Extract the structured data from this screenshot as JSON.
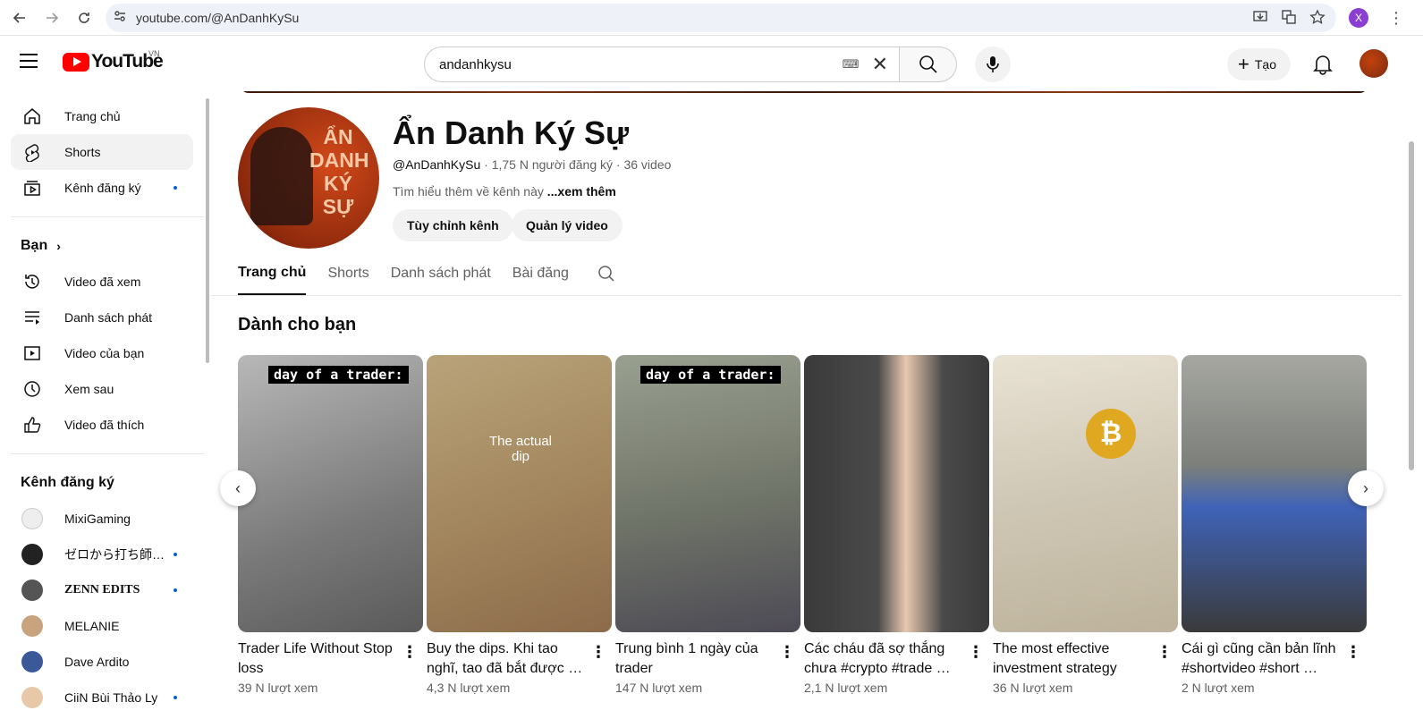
{
  "browser": {
    "url": "youtube.com/@AnDanhKySu",
    "profile_initial": "X"
  },
  "header": {
    "logo_text": "YouTube",
    "region": "VN",
    "search_value": "andanhkysu",
    "create_label": "Tạo"
  },
  "sidebar": {
    "main_items": [
      {
        "label": "Trang chủ",
        "icon": "home-icon"
      },
      {
        "label": "Shorts",
        "icon": "shorts-icon"
      },
      {
        "label": "Kênh đăng ký",
        "icon": "subscriptions-icon"
      }
    ],
    "you_heading": "Bạn",
    "you_items": [
      {
        "label": "Video đã xem",
        "icon": "history-icon"
      },
      {
        "label": "Danh sách phát",
        "icon": "playlist-icon"
      },
      {
        "label": "Video của bạn",
        "icon": "your-videos-icon"
      },
      {
        "label": "Xem sau",
        "icon": "watch-later-icon"
      },
      {
        "label": "Video đã thích",
        "icon": "like-icon"
      }
    ],
    "subs_heading": "Kênh đăng ký",
    "subscriptions": [
      {
        "label": "MixiGaming",
        "color": "#eeeeee",
        "new": false
      },
      {
        "label": "ゼロから打ち師…",
        "color": "#222222",
        "new": true
      },
      {
        "label": "ZENN EDITS",
        "color": "#555555",
        "new": true
      },
      {
        "label": "MELANIE",
        "color": "#c9a27e",
        "new": false
      },
      {
        "label": "Dave Ardito",
        "color": "#3b5998",
        "new": false
      },
      {
        "label": "CiiN Bùi Thảo Ly",
        "color": "#e7c9a9",
        "new": true
      }
    ]
  },
  "channel": {
    "avatar_text": "ẨN DANH KÝ SỰ",
    "name": "Ẩn Danh Ký Sự",
    "handle": "@AnDanhKySu",
    "subscribers": "· 1,75 N người đăng ký",
    "video_count": "· 36 video",
    "desc": "Tìm hiểu thêm về kênh này ",
    "more": "...xem thêm",
    "btn_customize": "Tùy chỉnh kênh",
    "btn_manage": "Quản lý video"
  },
  "tabs": [
    "Trang chủ",
    "Shorts",
    "Danh sách phát",
    "Bài đăng"
  ],
  "section_title": "Dành cho bạn",
  "shorts": [
    {
      "title": "Trader Life Without Stop loss",
      "views": "39 N lượt xem",
      "caption": "day of a trader:",
      "overlay": "",
      "bg": "linear-gradient(160deg,#b8b8b8,#7a7a7a 60%,#5a5a5a)"
    },
    {
      "title": "Buy the dips. Khi tao nghĩ, tao đã bắt được …",
      "views": "4,3 N lượt xem",
      "caption": "",
      "overlay": "The actual dip",
      "bg": "linear-gradient(160deg,#b9a37a,#a4885f 50%,#8c6b4a)"
    },
    {
      "title": "Trung bình 1 ngày của trader",
      "views": "147 N lượt xem",
      "caption": "day of a trader:",
      "overlay": "",
      "bg": "linear-gradient(170deg,#9aa090,#6f7468 55%,#4d4a55)"
    },
    {
      "title": "Các cháu đã sợ thắng chưa #crypto #trade …",
      "views": "2,1 N lượt xem",
      "caption": "",
      "overlay": "",
      "bg": "linear-gradient(90deg,#3a3a3a,#4a4a4a 40%,#e8c8b0 55%,#4a4a4a 75%,#3a3a3a)"
    },
    {
      "title": "The most effective investment strategy",
      "views": "36 N lượt xem",
      "caption": "",
      "overlay": "",
      "bg": "linear-gradient(170deg,#e9e3d4,#cfc7b5 50%,#bdb39c)"
    },
    {
      "title": "Cái gì cũng cần bản lĩnh #shortvideo #short …",
      "views": "2 N lượt xem",
      "caption": "",
      "overlay": "",
      "bg": "linear-gradient(180deg,#a6a7a1,#7c7f7a 40%,#3f63b8 55%,#3a3a3a)"
    }
  ]
}
